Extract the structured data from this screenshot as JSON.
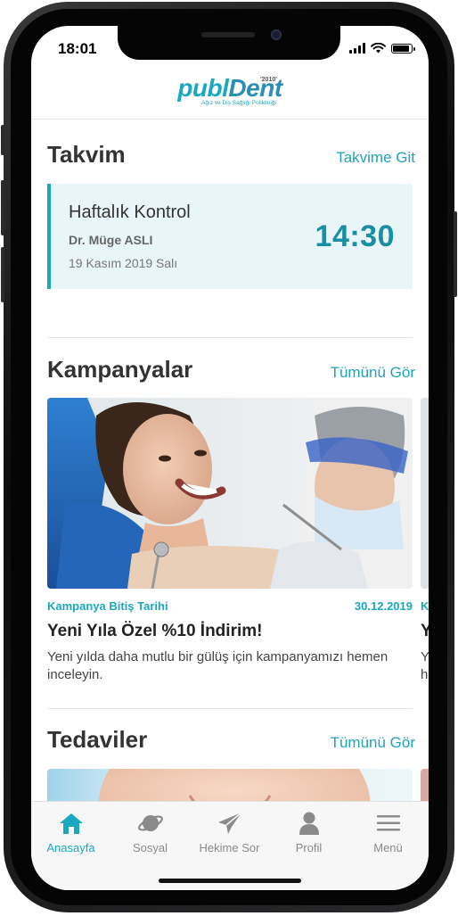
{
  "status": {
    "time": "18:01"
  },
  "brand": {
    "logo_left": "publ",
    "logo_right": "Dent",
    "year": "'2010'",
    "subtitle": "Ağız ve Diş Sağlığı Polikliniği"
  },
  "calendar": {
    "title": "Takvim",
    "link": "Takvime Git",
    "appointment": {
      "title": "Haftalık Kontrol",
      "doctor": "Dr. Müge ASLI",
      "date": "19 Kasım 2019 Salı",
      "time": "14:30"
    }
  },
  "campaigns": {
    "title": "Kampanyalar",
    "link": "Tümünü Gör",
    "items": [
      {
        "end_label": "Kampanya Bitiş Tarihi",
        "end_date": "30.12.2019",
        "title": "Yeni Yıla Özel %10 İndirim!",
        "description": "Yeni yılda daha mutlu bir gülüş için kampanyamızı hemen inceleyin."
      }
    ],
    "peek": {
      "meta": "K",
      "title": "Y",
      "desc1": "Y",
      "desc2": "h"
    }
  },
  "treatments": {
    "title": "Tedaviler",
    "link": "Tümünü Gör"
  },
  "tabbar": {
    "items": [
      {
        "label": "Anasayfa",
        "icon": "home-icon",
        "active": true
      },
      {
        "label": "Sosyal",
        "icon": "planet-icon",
        "active": false
      },
      {
        "label": "Hekime Sor",
        "icon": "paper-plane-icon",
        "active": false
      },
      {
        "label": "Profil",
        "icon": "person-icon",
        "active": false
      },
      {
        "label": "Menü",
        "icon": "hamburger-icon",
        "active": false
      }
    ]
  },
  "colors": {
    "accent": "#1ba8be",
    "time": "#1a8ea3",
    "card_bg": "#e9f6f9",
    "inactive_tab": "#8a8a8a"
  }
}
